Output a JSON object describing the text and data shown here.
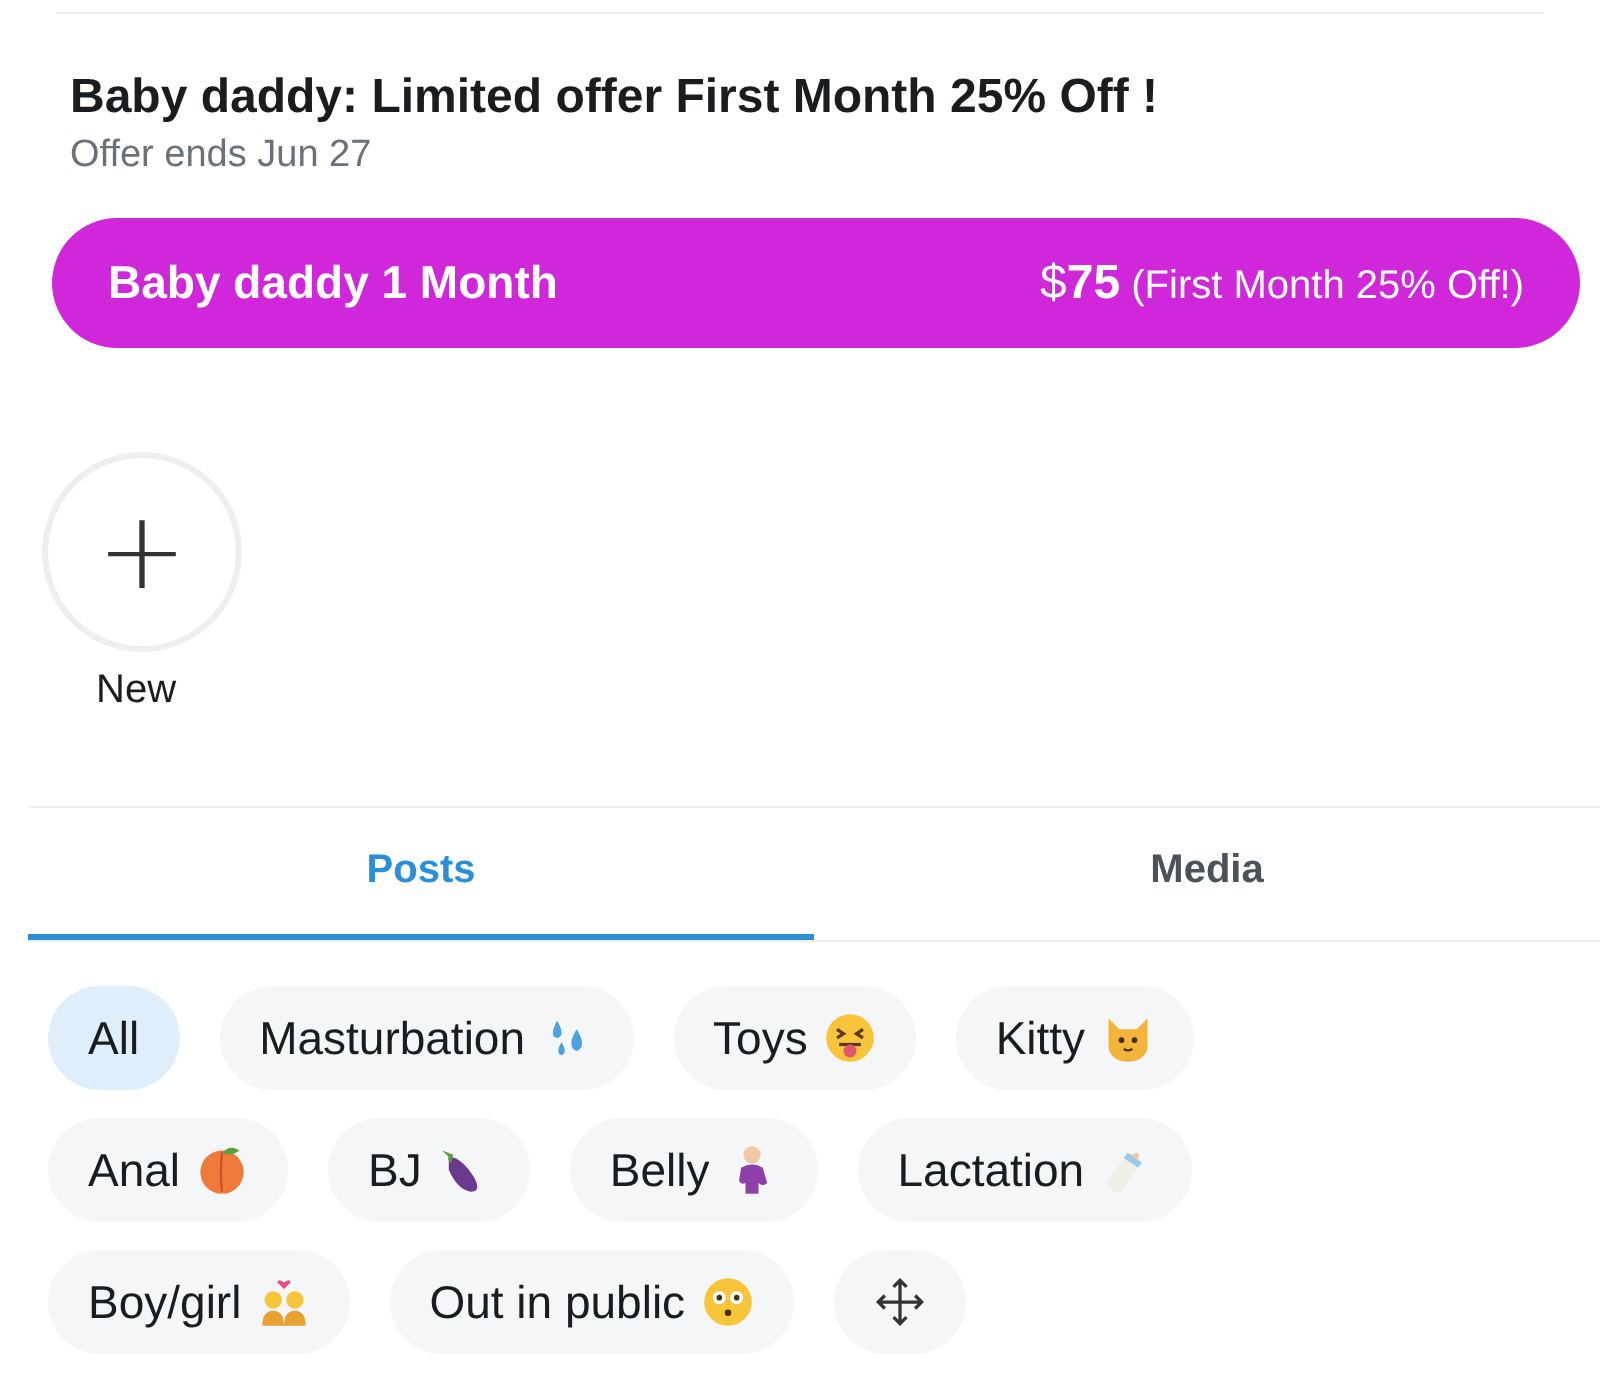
{
  "offer": {
    "title": "Baby daddy: Limited offer First Month 25% Off !",
    "subtitle": "Offer ends Jun 27"
  },
  "plan": {
    "name": "Baby daddy 1 Month",
    "currency": "$",
    "price": "75",
    "note": "(First Month 25% Off!)"
  },
  "new_button": {
    "symbol": "+",
    "label": "New"
  },
  "tabs": [
    {
      "label": "Posts",
      "selected": true
    },
    {
      "label": "Media",
      "selected": false
    }
  ],
  "tags": [
    {
      "label": "All",
      "selected": true,
      "kind": "plain"
    },
    {
      "label": "Masturbation",
      "selected": false,
      "kind": "droplets"
    },
    {
      "label": "Toys",
      "selected": false,
      "kind": "tongue-face"
    },
    {
      "label": "Kitty",
      "selected": false,
      "kind": "cat"
    },
    {
      "label": "Anal",
      "selected": false,
      "kind": "peach"
    },
    {
      "label": "BJ",
      "selected": false,
      "kind": "eggplant"
    },
    {
      "label": "Belly",
      "selected": false,
      "kind": "person"
    },
    {
      "label": "Lactation",
      "selected": false,
      "kind": "bottle"
    },
    {
      "label": "Boy/girl",
      "selected": false,
      "kind": "couple"
    },
    {
      "label": "Out in public",
      "selected": false,
      "kind": "flushed-face"
    },
    {
      "selected": false,
      "kind": "move"
    }
  ]
}
